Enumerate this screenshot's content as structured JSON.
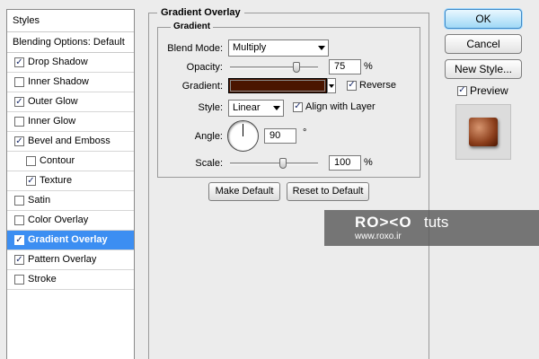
{
  "styles_panel": {
    "header": "Styles",
    "blending": "Blending Options: Default",
    "items": [
      {
        "label": "Drop Shadow",
        "checked": true
      },
      {
        "label": "Inner Shadow",
        "checked": false
      },
      {
        "label": "Outer Glow",
        "checked": true
      },
      {
        "label": "Inner Glow",
        "checked": false
      },
      {
        "label": "Bevel and Emboss",
        "checked": true
      },
      {
        "label": "Contour",
        "checked": false
      },
      {
        "label": "Texture",
        "checked": true
      },
      {
        "label": "Satin",
        "checked": false
      },
      {
        "label": "Color Overlay",
        "checked": false
      },
      {
        "label": "Gradient Overlay",
        "checked": true,
        "selected": true
      },
      {
        "label": "Pattern Overlay",
        "checked": true
      },
      {
        "label": "Stroke",
        "checked": false
      }
    ]
  },
  "gradient_overlay": {
    "title": "Gradient Overlay",
    "section": "Gradient",
    "blend_mode_label": "Blend Mode:",
    "blend_mode_value": "Multiply",
    "opacity_label": "Opacity:",
    "opacity_value": "75",
    "opacity_unit": "%",
    "opacity_level": 0.75,
    "gradient_label": "Gradient:",
    "gradient_color": "#4a1500",
    "reverse_label": "Reverse",
    "reverse_checked": true,
    "style_label": "Style:",
    "style_value": "Linear",
    "align_label": "Align with Layer",
    "align_checked": true,
    "angle_label": "Angle:",
    "angle_value": "90",
    "angle_unit": "°",
    "scale_label": "Scale:",
    "scale_value": "100",
    "scale_unit": "%",
    "scale_level": 0.6,
    "make_default": "Make Default",
    "reset_default": "Reset to Default"
  },
  "actions": {
    "ok": "OK",
    "cancel": "Cancel",
    "new_style": "New Style...",
    "preview_label": "Preview",
    "preview_checked": true
  },
  "watermark": {
    "brand": "RO><O",
    "tuts": "tuts",
    "url": "www.roxo.ir"
  },
  "check_mark": "✓"
}
